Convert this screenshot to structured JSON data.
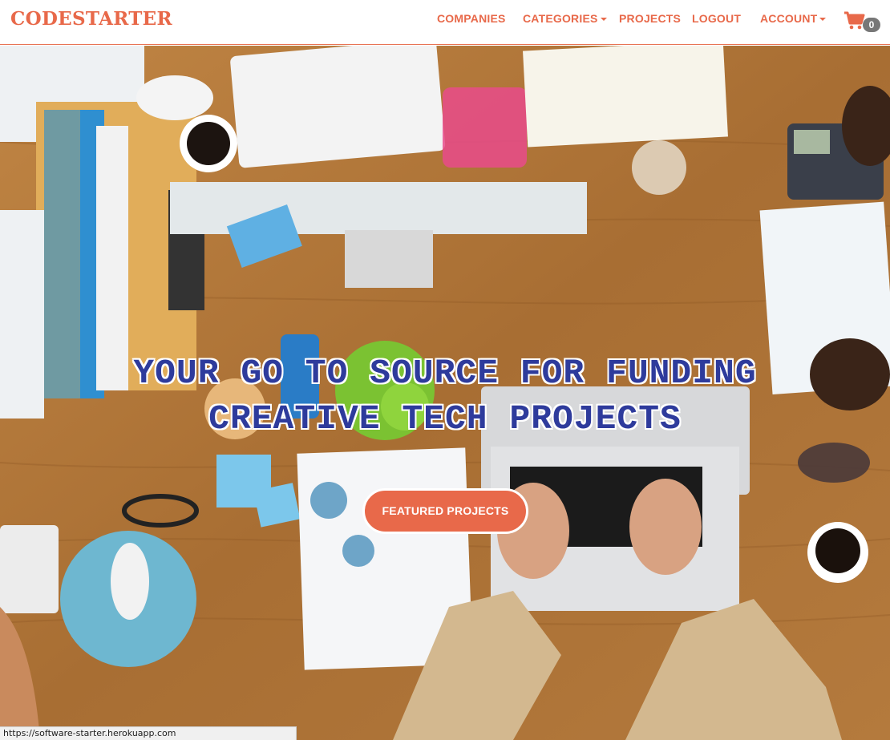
{
  "brand": "CODESTARTER",
  "nav": {
    "companies": "COMPANIES",
    "categories": "CATEGORIES",
    "projects": "PROJECTS",
    "logout": "LOGOUT",
    "account": "ACCOUNT"
  },
  "cart": {
    "icon": "shopping-cart-icon",
    "count": "0"
  },
  "hero": {
    "headline_line1": "YOUR GO TO SOURCE FOR FUNDING",
    "headline_line2": "CREATIVE TECH PROJECTS",
    "cta": "FEATURED PROJECTS"
  },
  "status_url": "https://software-starter.herokuapp.com",
  "colors": {
    "accent": "#e8694a",
    "headline": "#2e3b9c",
    "wood": "#b17a3c"
  }
}
